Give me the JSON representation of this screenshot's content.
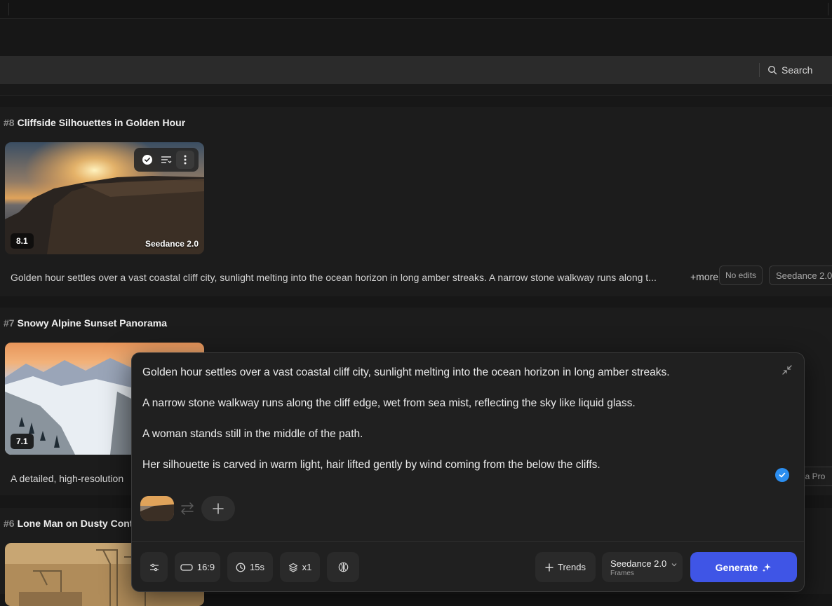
{
  "header": {
    "search_label": "Search"
  },
  "cards": [
    {
      "num": "#8",
      "title": "Cliffside Silhouettes in Golden Hour",
      "score": "8.1",
      "model": "Seedance 2.0",
      "description": "Golden hour settles over a vast coastal cliff city, sunlight melting into the ocean horizon in long amber streaks. A narrow stone walkway runs along t...",
      "more": "+more",
      "tags": [
        "No edits",
        "Seedance 2.0"
      ]
    },
    {
      "num": "#7",
      "title": "Snowy Alpine Sunset Panorama",
      "score": "7.1",
      "description": "A detailed, high-resolution",
      "tag_partial": "na Pro"
    },
    {
      "num": "#6",
      "title": "Lone Man on Dusty Cont"
    }
  ],
  "editor": {
    "prompt_lines": [
      "Golden hour settles over a vast coastal cliff city, sunlight melting into the ocean horizon in long amber streaks.",
      "A narrow stone walkway runs along the cliff edge, wet from sea mist, reflecting the sky like liquid glass.",
      "A woman stands still in the middle of the path.",
      "Her silhouette is carved in warm light, hair lifted gently by wind coming from the below the cliffs."
    ],
    "aspect_ratio": "16:9",
    "duration": "15s",
    "count": "x1",
    "trends_label": "Trends",
    "model_name": "Seedance 2.0",
    "model_sub": "Frames",
    "generate_label": "Generate"
  },
  "icons": {
    "search": "search-icon",
    "check": "check-circle-icon",
    "sliders": "adjust-icon",
    "more": "more-vertical-icon",
    "collapse": "collapse-icon",
    "swap": "swap-icon",
    "add": "plus-icon",
    "settings": "settings-sliders-icon",
    "aspect": "aspect-ratio-icon",
    "clock": "clock-icon",
    "layers": "layers-icon",
    "style": "style-icon",
    "chevron": "chevron-down-icon",
    "sparkle": "sparkle-icon"
  },
  "colors": {
    "accent": "#3f55e6",
    "check": "#2b8ef0"
  }
}
